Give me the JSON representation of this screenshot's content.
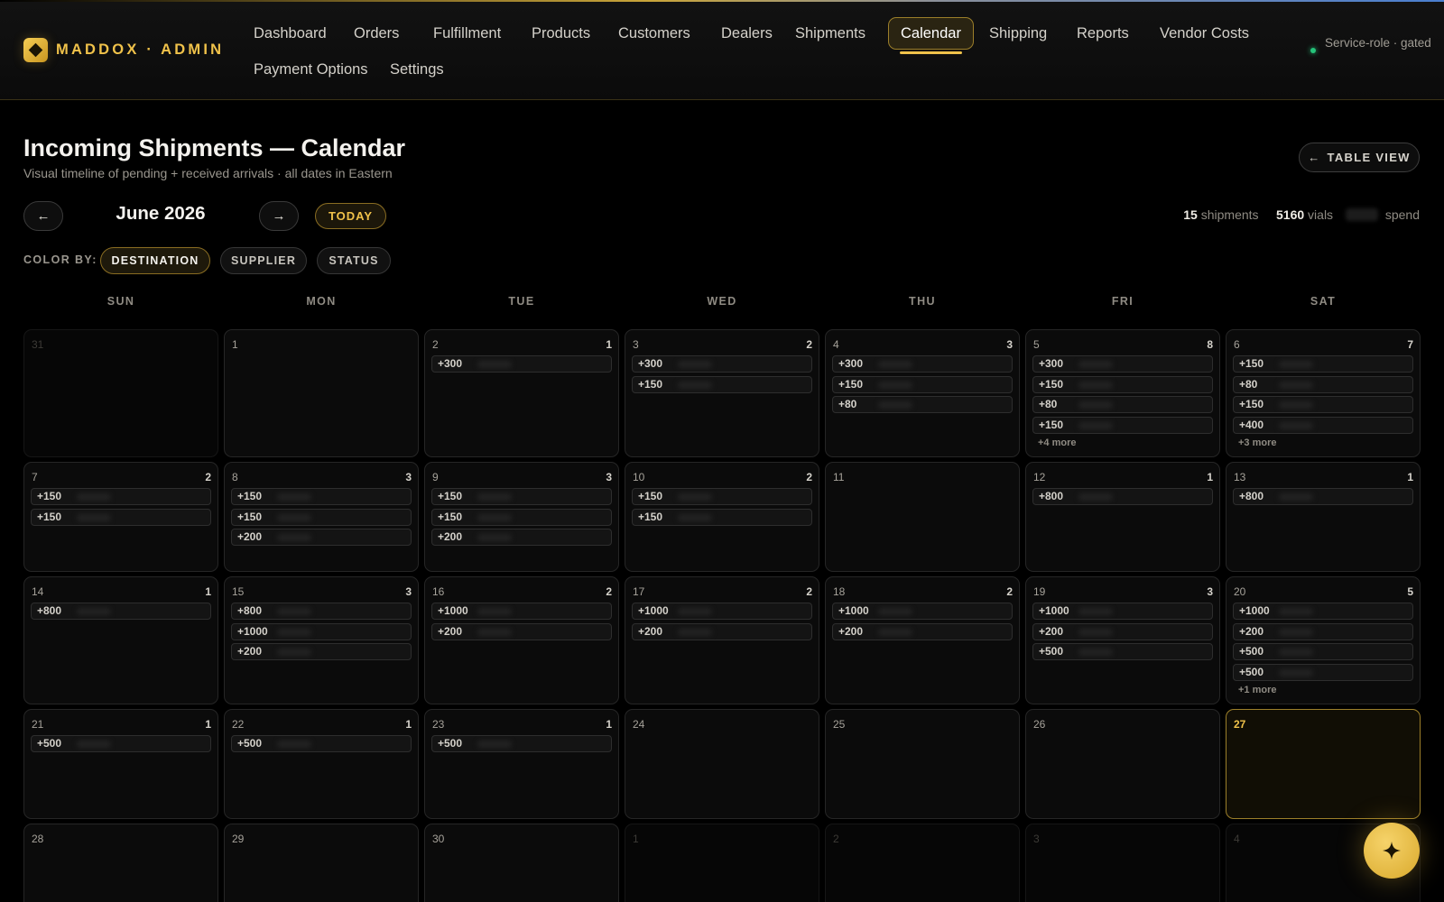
{
  "brand": {
    "name": "MADDOX · ADMIN",
    "icon": "diamond-logo-icon"
  },
  "nav": [
    {
      "label": "Dashboard",
      "active": false
    },
    {
      "label": "Orders",
      "active": false
    },
    {
      "label": "Fulfillment",
      "active": false
    },
    {
      "label": "Products",
      "active": false
    },
    {
      "label": "Customers",
      "active": false
    },
    {
      "label": "Dealers",
      "active": false
    },
    {
      "label": "Shipments",
      "active": false
    },
    {
      "label": "Calendar",
      "active": true
    },
    {
      "label": "Shipping",
      "active": false
    },
    {
      "label": "Reports",
      "active": false
    },
    {
      "label": "Vendor Costs",
      "active": false
    },
    {
      "label": "Payment Options",
      "active": false
    },
    {
      "label": "Settings",
      "active": false
    }
  ],
  "service_status": "Service-role · gated",
  "page": {
    "title": "Incoming Shipments — Calendar",
    "subtitle": "Visual timeline of pending + received arrivals · all dates in Eastern",
    "table_view_label": "TABLE VIEW"
  },
  "calendar": {
    "month_label": "June 2026",
    "today_label": "TODAY",
    "prev_icon": "arrow-left-icon",
    "next_icon": "arrow-right-icon",
    "stats": {
      "shipments_count": "15",
      "shipments_label": "shipments",
      "vials_count": "5160",
      "vials_label": "vials",
      "spend_label": "spend"
    },
    "color_by_label": "COLOR BY:",
    "color_by_options": [
      {
        "label": "DESTINATION",
        "active": true
      },
      {
        "label": "SUPPLIER",
        "active": false
      },
      {
        "label": "STATUS",
        "active": false
      }
    ],
    "weekdays": [
      "SUN",
      "MON",
      "TUE",
      "WED",
      "THU",
      "FRI",
      "SAT"
    ],
    "weeks": [
      [
        {
          "day": "31",
          "out": true,
          "count": "",
          "items": [],
          "more": ""
        },
        {
          "day": "1",
          "count": "",
          "items": [],
          "more": ""
        },
        {
          "day": "2",
          "count": "1",
          "items": [
            "+300"
          ],
          "more": ""
        },
        {
          "day": "3",
          "count": "2",
          "items": [
            "+300",
            "+150"
          ],
          "more": ""
        },
        {
          "day": "4",
          "count": "3",
          "items": [
            "+300",
            "+150",
            "+80"
          ],
          "more": ""
        },
        {
          "day": "5",
          "count": "8",
          "items": [
            "+300",
            "+150",
            "+80",
            "+150"
          ],
          "more": "+4 more"
        },
        {
          "day": "6",
          "count": "7",
          "items": [
            "+150",
            "+80",
            "+150",
            "+400"
          ],
          "more": "+3 more"
        }
      ],
      [
        {
          "day": "7",
          "count": "2",
          "items": [
            "+150",
            "+150"
          ],
          "more": ""
        },
        {
          "day": "8",
          "count": "3",
          "items": [
            "+150",
            "+150",
            "+200"
          ],
          "more": ""
        },
        {
          "day": "9",
          "count": "3",
          "items": [
            "+150",
            "+150",
            "+200"
          ],
          "more": ""
        },
        {
          "day": "10",
          "count": "2",
          "items": [
            "+150",
            "+150"
          ],
          "more": ""
        },
        {
          "day": "11",
          "count": "",
          "items": [],
          "more": ""
        },
        {
          "day": "12",
          "count": "1",
          "items": [
            "+800"
          ],
          "more": ""
        },
        {
          "day": "13",
          "count": "1",
          "items": [
            "+800"
          ],
          "more": ""
        }
      ],
      [
        {
          "day": "14",
          "count": "1",
          "items": [
            "+800"
          ],
          "more": ""
        },
        {
          "day": "15",
          "count": "3",
          "items": [
            "+800",
            "+1000",
            "+200"
          ],
          "more": ""
        },
        {
          "day": "16",
          "count": "2",
          "items": [
            "+1000",
            "+200"
          ],
          "more": ""
        },
        {
          "day": "17",
          "count": "2",
          "items": [
            "+1000",
            "+200"
          ],
          "more": ""
        },
        {
          "day": "18",
          "count": "2",
          "items": [
            "+1000",
            "+200"
          ],
          "more": ""
        },
        {
          "day": "19",
          "count": "3",
          "items": [
            "+1000",
            "+200",
            "+500"
          ],
          "more": ""
        },
        {
          "day": "20",
          "count": "5",
          "items": [
            "+1000",
            "+200",
            "+500",
            "+500"
          ],
          "more": "+1 more"
        }
      ],
      [
        {
          "day": "21",
          "count": "1",
          "items": [
            "+500"
          ],
          "more": ""
        },
        {
          "day": "22",
          "count": "1",
          "items": [
            "+500"
          ],
          "more": ""
        },
        {
          "day": "23",
          "count": "1",
          "items": [
            "+500"
          ],
          "more": ""
        },
        {
          "day": "24",
          "count": "",
          "items": [],
          "more": ""
        },
        {
          "day": "25",
          "count": "",
          "items": [],
          "more": ""
        },
        {
          "day": "26",
          "count": "",
          "items": [],
          "more": ""
        },
        {
          "day": "27",
          "today": true,
          "count": "",
          "items": [],
          "more": ""
        }
      ],
      [
        {
          "day": "28",
          "count": "",
          "items": [],
          "more": ""
        },
        {
          "day": "29",
          "count": "",
          "items": [],
          "more": ""
        },
        {
          "day": "30",
          "count": "",
          "items": [],
          "more": ""
        },
        {
          "day": "1",
          "out": true,
          "count": "",
          "items": [],
          "more": ""
        },
        {
          "day": "2",
          "out": true,
          "count": "",
          "items": [],
          "more": ""
        },
        {
          "day": "3",
          "out": true,
          "count": "",
          "items": [],
          "more": ""
        },
        {
          "day": "4",
          "out": true,
          "count": "",
          "items": [],
          "more": ""
        }
      ]
    ]
  },
  "fab_icon": "sparkle-icon",
  "colors": {
    "accent": "#f0c24a",
    "status_dot": "#25c47a",
    "background": "#000000"
  }
}
